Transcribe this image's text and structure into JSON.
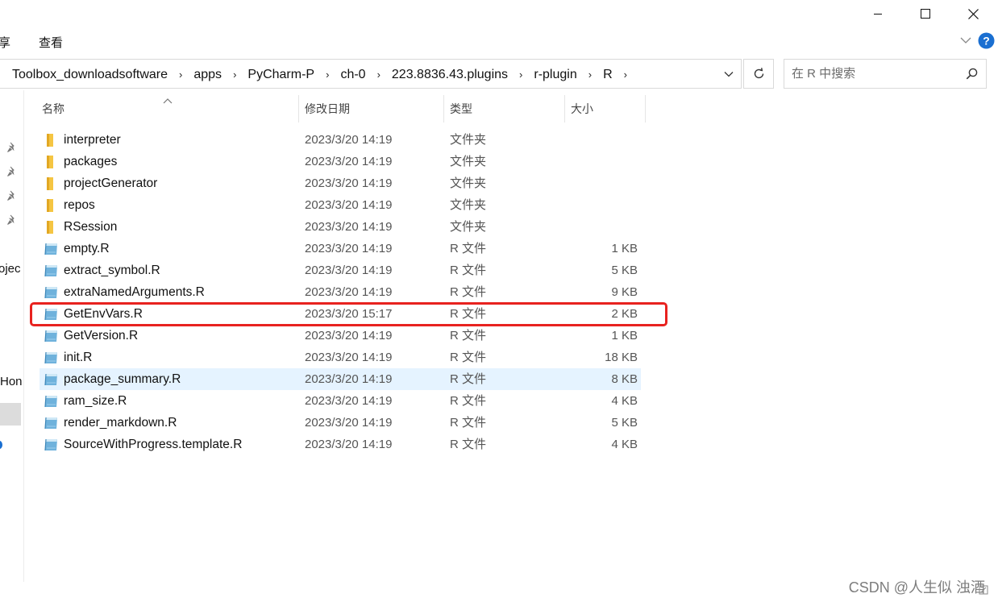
{
  "ribbon": {
    "tab_share_partial": "享",
    "tab_view": "查看"
  },
  "address": {
    "crumbs": [
      "Toolbox_downloadsoftware",
      "apps",
      "PyCharm-P",
      "ch-0",
      "223.8836.43.plugins",
      "r-plugin",
      "R"
    ],
    "separator": "›"
  },
  "search": {
    "placeholder": "在 R 中搜索"
  },
  "nav": {
    "partial_project": "ojec",
    "partial_home": "Hon"
  },
  "columns": {
    "name": "名称",
    "date": "修改日期",
    "type": "类型",
    "size": "大小"
  },
  "files": [
    {
      "name": "interpreter",
      "date": "2023/3/20 14:19",
      "type": "文件夹",
      "size": "",
      "kind": "folder"
    },
    {
      "name": "packages",
      "date": "2023/3/20 14:19",
      "type": "文件夹",
      "size": "",
      "kind": "folder"
    },
    {
      "name": "projectGenerator",
      "date": "2023/3/20 14:19",
      "type": "文件夹",
      "size": "",
      "kind": "folder"
    },
    {
      "name": "repos",
      "date": "2023/3/20 14:19",
      "type": "文件夹",
      "size": "",
      "kind": "folder"
    },
    {
      "name": "RSession",
      "date": "2023/3/20 14:19",
      "type": "文件夹",
      "size": "",
      "kind": "folder"
    },
    {
      "name": "empty.R",
      "date": "2023/3/20 14:19",
      "type": "R 文件",
      "size": "1 KB",
      "kind": "rfile"
    },
    {
      "name": "extract_symbol.R",
      "date": "2023/3/20 14:19",
      "type": "R 文件",
      "size": "5 KB",
      "kind": "rfile"
    },
    {
      "name": "extraNamedArguments.R",
      "date": "2023/3/20 14:19",
      "type": "R 文件",
      "size": "9 KB",
      "kind": "rfile"
    },
    {
      "name": "GetEnvVars.R",
      "date": "2023/3/20 15:17",
      "type": "R 文件",
      "size": "2 KB",
      "kind": "rfile"
    },
    {
      "name": "GetVersion.R",
      "date": "2023/3/20 14:19",
      "type": "R 文件",
      "size": "1 KB",
      "kind": "rfile"
    },
    {
      "name": "init.R",
      "date": "2023/3/20 14:19",
      "type": "R 文件",
      "size": "18 KB",
      "kind": "rfile"
    },
    {
      "name": "package_summary.R",
      "date": "2023/3/20 14:19",
      "type": "R 文件",
      "size": "8 KB",
      "kind": "rfile"
    },
    {
      "name": "ram_size.R",
      "date": "2023/3/20 14:19",
      "type": "R 文件",
      "size": "4 KB",
      "kind": "rfile"
    },
    {
      "name": "render_markdown.R",
      "date": "2023/3/20 14:19",
      "type": "R 文件",
      "size": "5 KB",
      "kind": "rfile"
    },
    {
      "name": "SourceWithProgress.template.R",
      "date": "2023/3/20 14:19",
      "type": "R 文件",
      "size": "4 KB",
      "kind": "rfile"
    }
  ],
  "hovered_file": "package_summary.R",
  "highlighted_file": "GetEnvVars.R",
  "colors": {
    "highlight_border": "#e8221f",
    "hover_row": "#e5f3ff",
    "help_icon": "#1a6fd1",
    "folder": "#f5c542"
  },
  "watermark": "CSDN @人生似 浊酒"
}
